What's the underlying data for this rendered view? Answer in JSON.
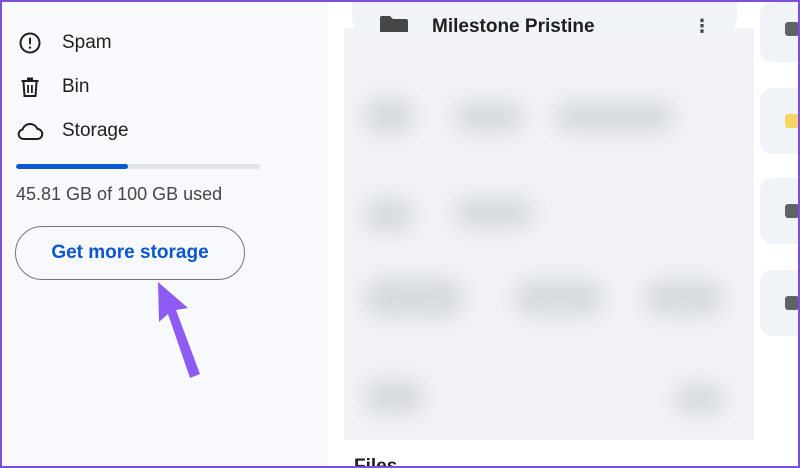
{
  "sidebar": {
    "items": [
      {
        "label": "Spam",
        "icon": "spam-icon"
      },
      {
        "label": "Bin",
        "icon": "bin-icon"
      },
      {
        "label": "Storage",
        "icon": "cloud-icon"
      }
    ],
    "storage": {
      "used_fraction": 0.4581,
      "usage_text": "45.81 GB of 100 GB used",
      "button_label": "Get more storage"
    }
  },
  "main": {
    "folder": {
      "name": "Milestone Pristine",
      "icon": "folder-icon",
      "menu_icon": "more-vert-icon"
    },
    "files_heading": "Files"
  },
  "colors": {
    "accent": "#0b57d0",
    "annotation_arrow": "#8e5cf5",
    "frame": "#7b4fd6",
    "folder_chip": "#f6d365"
  }
}
